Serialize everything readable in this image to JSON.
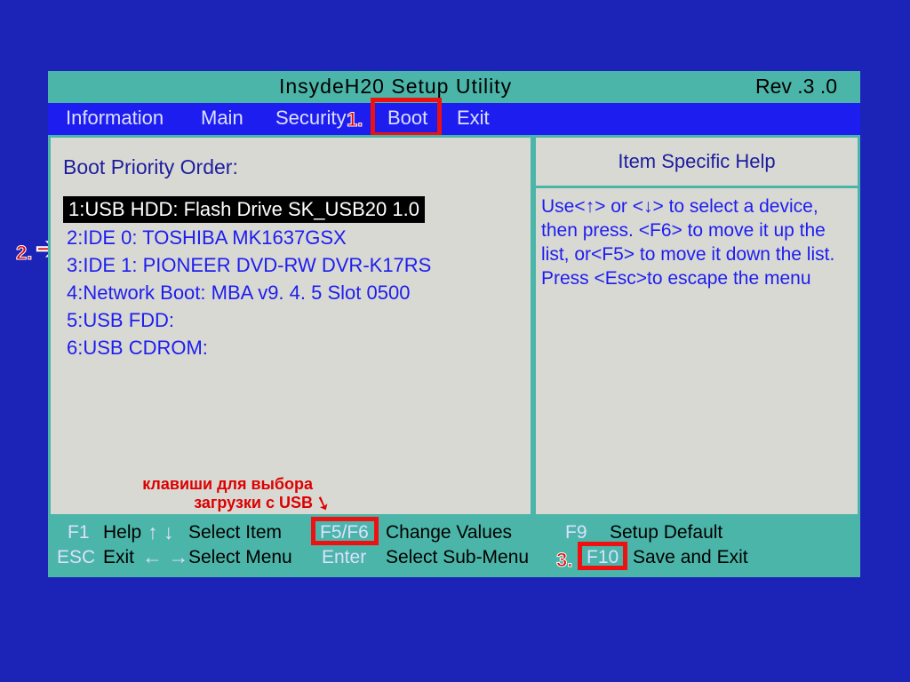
{
  "title": {
    "center": "InsydeH20  Setup  Utility",
    "rev": "Rev .3 .0"
  },
  "menu": {
    "information": "Information",
    "main": "Main",
    "security": "Security",
    "boot": "Boot",
    "exit": "Exit"
  },
  "left": {
    "heading": "Boot Priority Order:",
    "items": [
      "1:USB HDD:  Flash Drive  SK_USB20  1.0",
      "2:IDE 0: TOSHIBA MK1637GSX",
      "3:IDE 1: PIONEER DVD-RW  DVR-K17RS",
      "4:Network Boot:  MBA  v9. 4. 5  Slot  0500",
      "5:USB FDD:",
      "6:USB CDROM:"
    ]
  },
  "right": {
    "header": "Item Specific Help",
    "body": "Use<↑> or <↓> to select a device,  then press. <F6> to move it up the list, or<F5> to move it down the list. Press <Esc>to escape the menu"
  },
  "footer": {
    "f1": "F1",
    "help": "Help",
    "selectItem": "Select Item",
    "f5f6": "F5/F6",
    "changeValues": "Change Values",
    "f9": "F9",
    "setupDefault": "Setup Default",
    "esc": "ESC",
    "exit": "Exit",
    "selectMenu": "Select Menu",
    "enter": "Enter",
    "selectSubMenu": "Select  Sub-Menu",
    "f10": "F10",
    "saveExit": "Save and Exit"
  },
  "annot": {
    "n1": "1.",
    "n2": "2.",
    "n3": "3.",
    "usbHint": "клавиши для выбора\nзагрузки с USB"
  }
}
